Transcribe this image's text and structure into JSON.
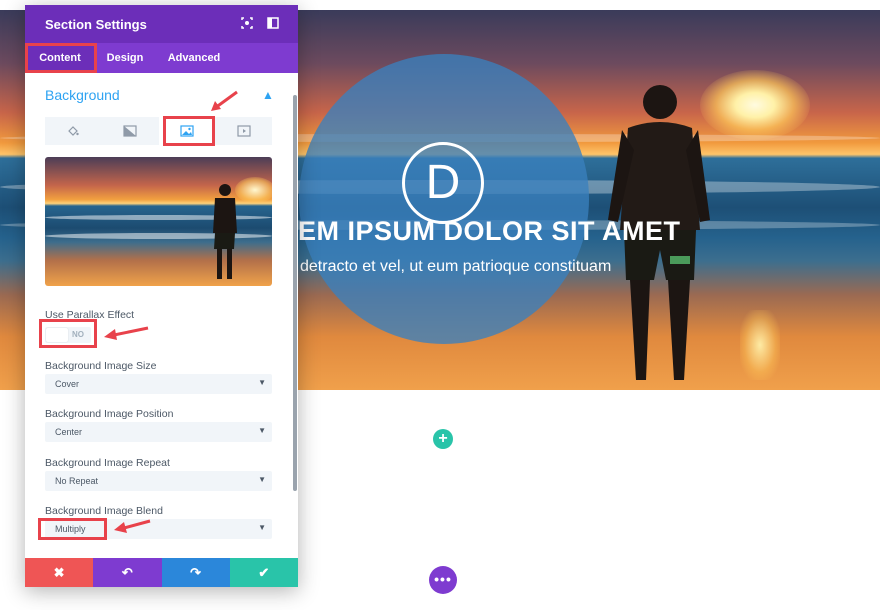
{
  "panel": {
    "title": "Section Settings",
    "header_icons": [
      "screenshot-icon",
      "sidebar-toggle-icon"
    ],
    "tabs": [
      {
        "label": "Content",
        "active": true
      },
      {
        "label": "Design",
        "active": false
      },
      {
        "label": "Advanced",
        "active": false
      }
    ],
    "section_title": "Background",
    "bg_tabs": [
      "paint-bucket-icon",
      "gradient-icon",
      "image-icon",
      "video-icon"
    ],
    "active_bg_tab": "image-icon",
    "fields": {
      "parallax": {
        "label": "Use Parallax Effect",
        "value": "NO"
      },
      "size": {
        "label": "Background Image Size",
        "value": "Cover"
      },
      "position": {
        "label": "Background Image Position",
        "value": "Center"
      },
      "repeat": {
        "label": "Background Image Repeat",
        "value": "No Repeat"
      },
      "blend": {
        "label": "Background Image Blend",
        "value": "Multiply"
      }
    },
    "footer_buttons": [
      {
        "icon": "close-icon",
        "glyph": "✖",
        "color": "#ef5555"
      },
      {
        "icon": "undo-icon",
        "glyph": "↶",
        "color": "#7e3bd0"
      },
      {
        "icon": "redo-icon",
        "glyph": "↷",
        "color": "#2b87da"
      },
      {
        "icon": "check-icon",
        "glyph": "✔",
        "color": "#29c4a9"
      }
    ]
  },
  "hero": {
    "logo_letter": "D",
    "title": "EM IPSUM DOLOR SIT AMET",
    "subtitle": "detracto et vel, ut eum patrioque constituam"
  },
  "canvas": {
    "add_glyph": "+",
    "more_glyph": "•••"
  },
  "colors": {
    "purple_dark": "#6c2eb9",
    "purple": "#7e3bd0",
    "accent_blue": "#2ea3f2",
    "highlight_red": "#e8424b",
    "teal": "#29c4a9"
  }
}
